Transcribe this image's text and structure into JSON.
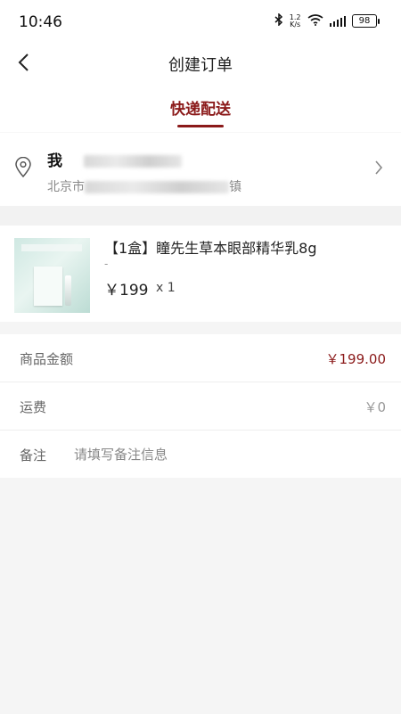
{
  "status_bar": {
    "time": "10:46",
    "speed_top": "1.2",
    "speed_bottom": "K/s",
    "battery": "98"
  },
  "header": {
    "title": "创建订单"
  },
  "tabs": {
    "active": "快递配送"
  },
  "address": {
    "name": "我",
    "detail": "北京市",
    "detail_suffix": "镇"
  },
  "product": {
    "title": "【1盒】瞳先生草本眼部精华乳8g",
    "spec": "-",
    "price": "￥199",
    "quantity": "x 1"
  },
  "summary": {
    "goods_amount_label": "商品金额",
    "goods_amount_value": "￥199.00",
    "shipping_label": "运费",
    "shipping_value": "￥0",
    "remark_label": "备注",
    "remark_placeholder": "请填写备注信息"
  },
  "colors": {
    "accent": "#8b1a1a",
    "background": "#f5f5f5"
  }
}
